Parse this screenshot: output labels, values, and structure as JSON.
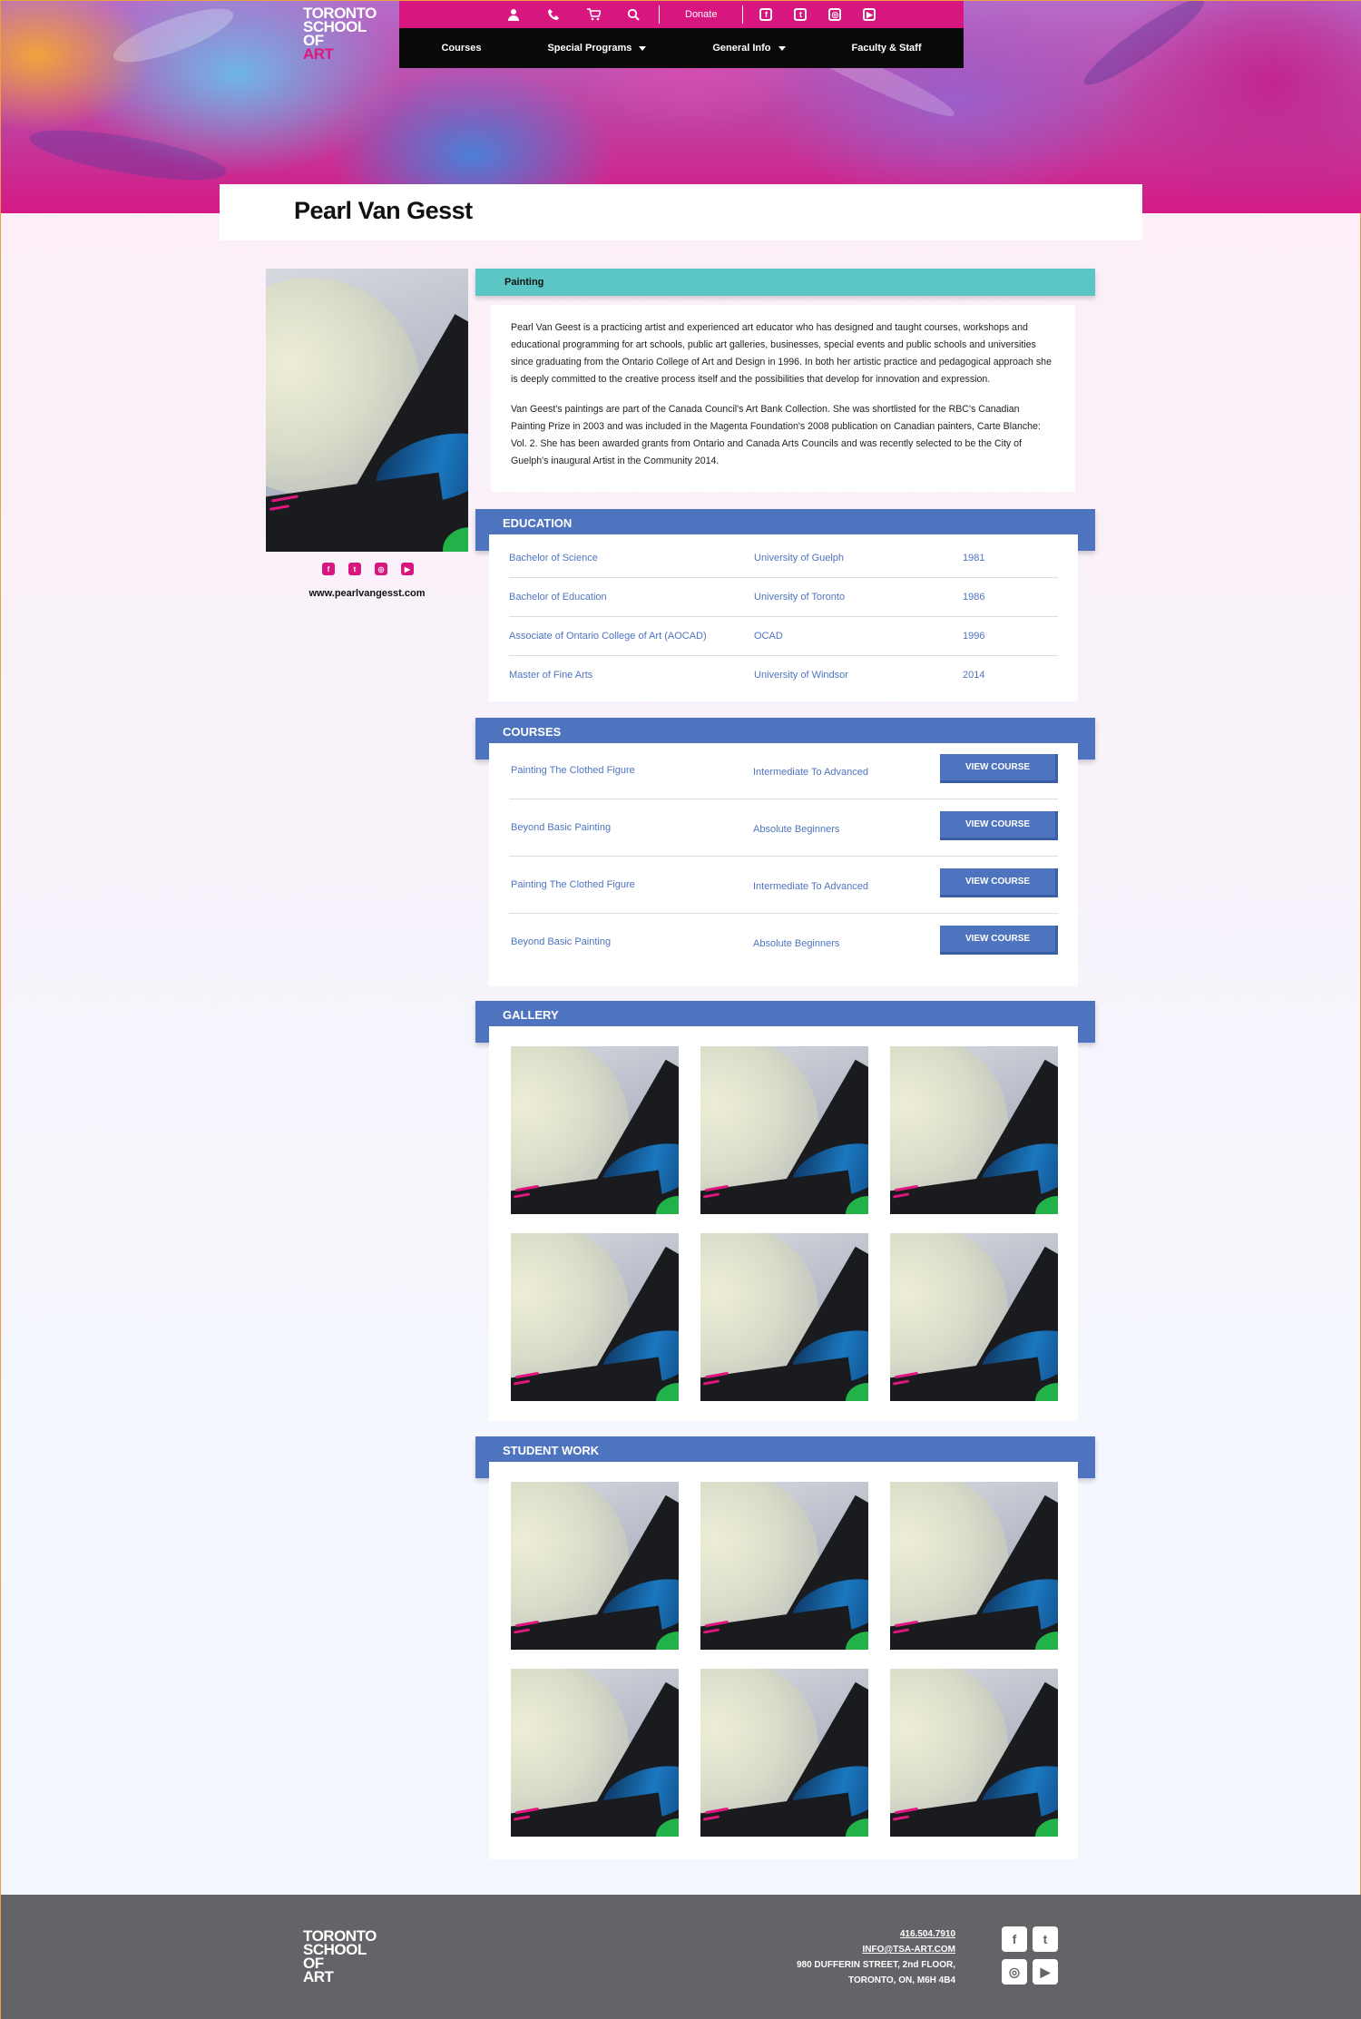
{
  "brand": {
    "logo_lines": [
      "TORONTO",
      "SCHOOL",
      "OF",
      "ART"
    ]
  },
  "header": {
    "utility_icons": [
      "user-icon",
      "phone-icon",
      "cart-icon",
      "search-icon"
    ],
    "donate_label": "Donate",
    "social_icons": [
      {
        "name": "facebook-icon",
        "glyph": "f"
      },
      {
        "name": "twitter-icon",
        "glyph": "t"
      },
      {
        "name": "instagram-icon",
        "glyph": "◎"
      },
      {
        "name": "youtube-icon",
        "glyph": "▶"
      }
    ],
    "nav": [
      {
        "label": "Courses",
        "has_dropdown": false
      },
      {
        "label": "Special Programs",
        "has_dropdown": true
      },
      {
        "label": "General Info",
        "has_dropdown": true
      },
      {
        "label": "Faculty & Staff",
        "has_dropdown": false
      }
    ],
    "accent_color": "#d8167f"
  },
  "profile": {
    "name": "Pearl Van Gesst",
    "website": "www.pearlvangesst.com",
    "category": "Painting",
    "bio": [
      "Pearl Van Geest is a practicing artist and experienced art educator who has designed and taught courses, workshops and educational programming for art schools, public art galleries, businesses, special events and public schools and universities since graduating from the Ontario College of Art and Design in 1996. In both her artistic practice and pedagogical approach she is deeply committed to the creative process itself and the possibilities that develop for innovation and expression.",
      "Van Geest's paintings are part of the Canada Council's Art Bank Collection. She was shortlisted for the RBC's Canadian Painting Prize in 2003 and was included in the Magenta Foundation's 2008 publication on Canadian painters, Carte Blanche: Vol. 2. She has been awarded grants from Ontario and Canada Arts Councils and was recently selected to be the City of Guelph's inaugural Artist in the Community 2014."
    ]
  },
  "education": {
    "heading": "EDUCATION",
    "rows": [
      {
        "degree": "Bachelor of Science",
        "school": "University of Guelph",
        "year": "1981"
      },
      {
        "degree": "Bachelor of Education",
        "school": "University of Toronto",
        "year": "1986"
      },
      {
        "degree": "Associate of Ontario College of Art (AOCAD)",
        "school": "OCAD",
        "year": "1996"
      },
      {
        "degree": "Master of Fine Arts",
        "school": "University of Windsor",
        "year": "2014"
      }
    ]
  },
  "courses": {
    "heading": "COURSES",
    "button_label": "VIEW COURSE",
    "rows": [
      {
        "title": "Painting The Clothed Figure",
        "level": "Intermediate To Advanced"
      },
      {
        "title": "Beyond Basic Painting",
        "level": "Absolute Beginners"
      },
      {
        "title": "Painting The Clothed Figure",
        "level": "Intermediate To Advanced"
      },
      {
        "title": "Beyond Basic Painting",
        "level": "Absolute Beginners"
      }
    ]
  },
  "gallery": {
    "heading": "GALLERY",
    "count": 6
  },
  "student_work": {
    "heading": "STUDENT WORK",
    "count": 6
  },
  "footer": {
    "phone": "416.504.7910",
    "email": "INFO@TSA-ART.COM",
    "address_line1": "980 DUFFERIN STREET, 2nd FLOOR,",
    "address_line2": "TORONTO, ON, M6H 4B4",
    "social_icons": [
      {
        "name": "facebook-icon",
        "glyph": "f"
      },
      {
        "name": "twitter-icon",
        "glyph": "t"
      },
      {
        "name": "instagram-icon",
        "glyph": "◎"
      },
      {
        "name": "youtube-icon",
        "glyph": "▶"
      }
    ]
  },
  "colors": {
    "primary_blue": "#4e74c0",
    "teal": "#5bc6c4",
    "magenta": "#d8167f",
    "footer_gray": "#636468"
  }
}
